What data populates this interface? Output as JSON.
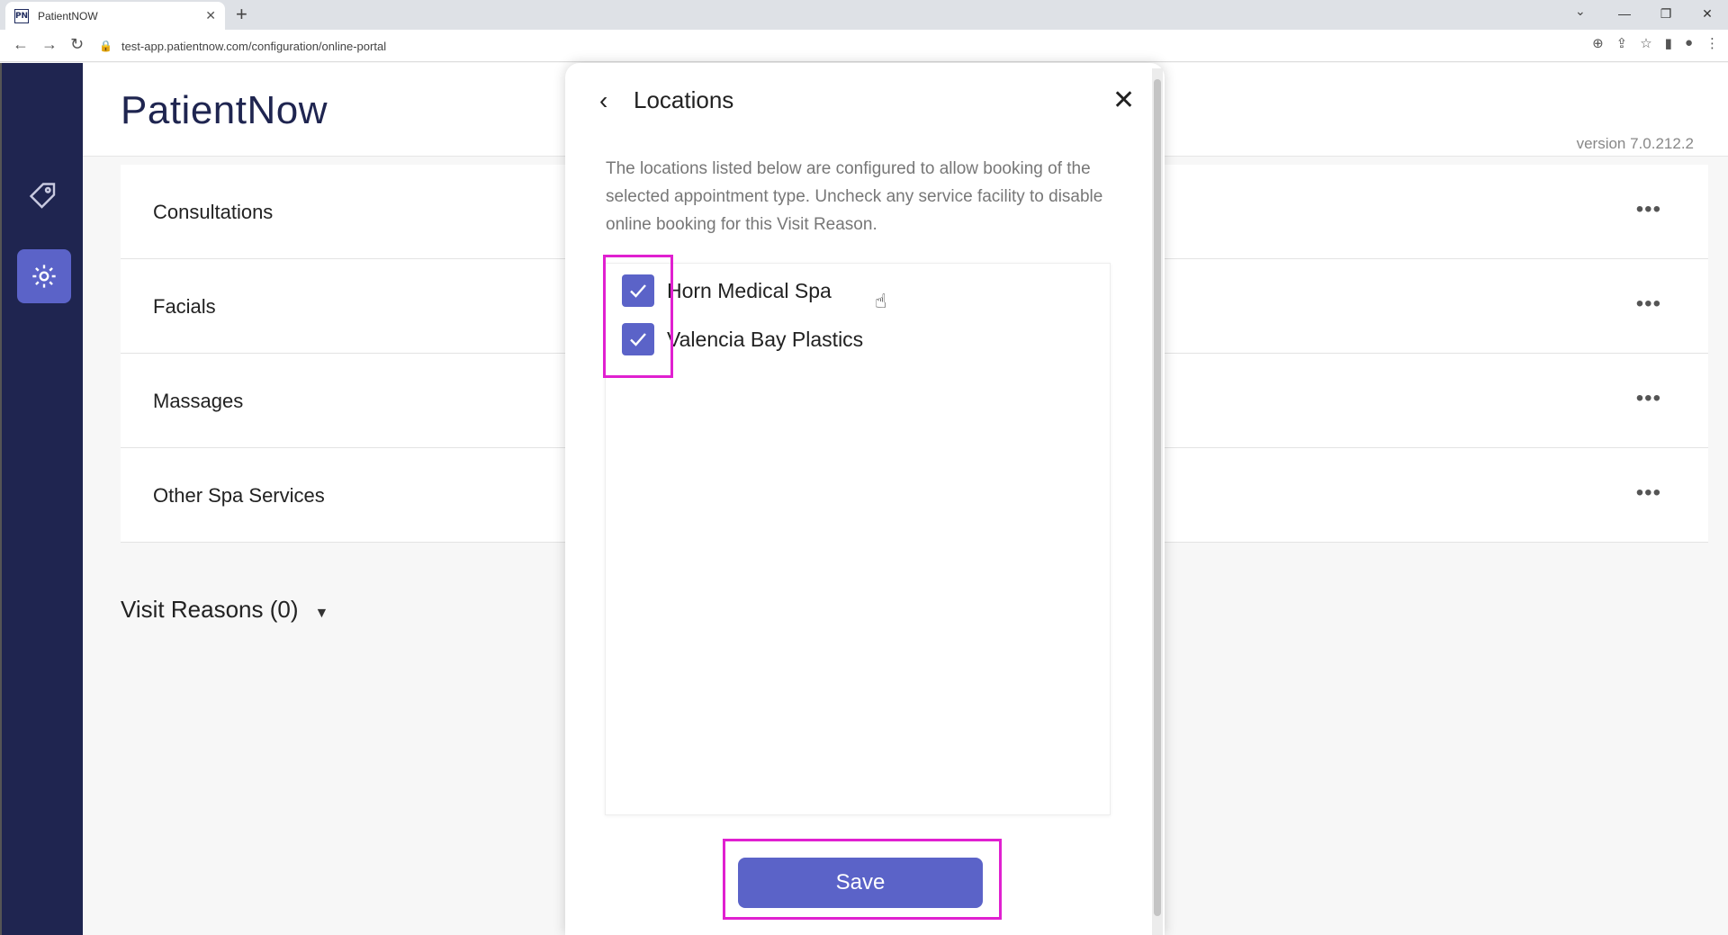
{
  "browser": {
    "tab_title": "PatientNOW",
    "favicon_text": "PN",
    "url": "test-app.patientnow.com/configuration/online-portal"
  },
  "app": {
    "brand": "PatientNow",
    "version": "version 7.0.212.2"
  },
  "categories": [
    {
      "label": "Consultations"
    },
    {
      "label": "Facials"
    },
    {
      "label": "Massages"
    },
    {
      "label": "Other Spa Services"
    }
  ],
  "visit_reasons": {
    "label": "Visit Reasons (0)"
  },
  "modal": {
    "title": "Locations",
    "description": "The locations listed below are configured to allow booking of the selected appointment type. Uncheck any service facility to disable online booking for this Visit Reason.",
    "locations": [
      {
        "label": "Horn Medical Spa",
        "checked": true
      },
      {
        "label": "Valencia Bay Plastics",
        "checked": true
      }
    ],
    "save_label": "Save"
  },
  "colors": {
    "accent": "#5b63c8",
    "nav_bg": "#1f2550",
    "highlight": "#e020d0"
  }
}
